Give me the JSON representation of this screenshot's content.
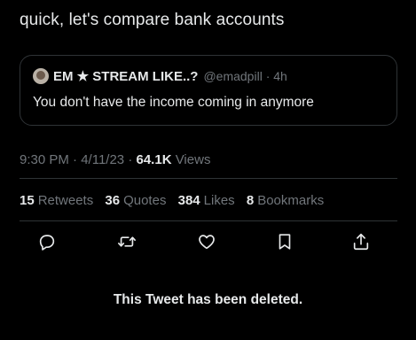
{
  "tweet": {
    "text": "quick, let's compare bank accounts",
    "time": "9:30 PM",
    "separator": "·",
    "date": "4/11/23",
    "views_count": "64.1K",
    "views_label": "Views"
  },
  "quote": {
    "display_name": "EM ★ STREAM LIKE..?",
    "handle": "@emadpill",
    "age": "4h",
    "text": "You don't have the income coming in anymore"
  },
  "stats": {
    "retweets_count": "15",
    "retweets_label": "Retweets",
    "quotes_count": "36",
    "quotes_label": "Quotes",
    "likes_count": "384",
    "likes_label": "Likes",
    "bookmarks_count": "8",
    "bookmarks_label": "Bookmarks"
  },
  "actions": [
    "reply-icon",
    "retweet-icon",
    "like-icon",
    "bookmark-icon",
    "share-icon"
  ],
  "deleted_notice": "This Tweet has been deleted.",
  "colors": {
    "background": "#000000",
    "primary_text": "#e7e9ea",
    "secondary_text": "#71767b",
    "border": "#2f3336"
  }
}
